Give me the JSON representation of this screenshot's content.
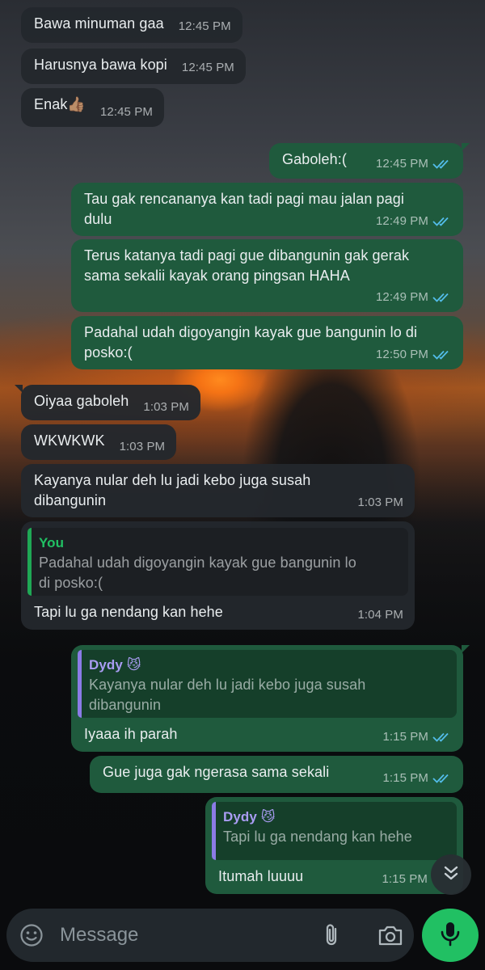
{
  "messages": [
    {
      "text": "Bawa minuman gaa",
      "time": "12:45 PM"
    },
    {
      "text": "Harusnya bawa kopi",
      "time": "12:45 PM"
    },
    {
      "text": "Enak👍🏽",
      "time": "12:45 PM"
    },
    {
      "text": "Gaboleh:(",
      "time": "12:45 PM"
    },
    {
      "text": "Tau gak rencananya kan tadi pagi mau jalan pagi dulu",
      "time": "12:49 PM"
    },
    {
      "text": "Terus katanya tadi pagi gue dibangunin gak gerak sama sekalii kayak orang pingsan HAHA",
      "time": "12:49 PM"
    },
    {
      "text": "Padahal udah digoyangin kayak gue bangunin lo di posko:(",
      "time": "12:50 PM"
    },
    {
      "text": "Oiyaa gaboleh",
      "time": "1:03 PM"
    },
    {
      "text": "WKWKWK",
      "time": "1:03 PM"
    },
    {
      "text": "Kayanya nular deh lu jadi kebo juga susah dibangunin",
      "time": "1:03 PM"
    },
    {
      "text": "Tapi lu ga nendang kan hehe",
      "time": "1:04 PM",
      "quote": {
        "name": "You",
        "text": "Padahal udah digoyangin kayak gue bangunin lo di posko:("
      }
    },
    {
      "text": "Iyaaa ih parah",
      "time": "1:15 PM",
      "quote": {
        "name": "Dydy 😼",
        "text": "Kayanya nular deh lu jadi kebo juga susah dibangunin"
      }
    },
    {
      "text": "Gue juga gak ngerasa sama sekali",
      "time": "1:15 PM"
    },
    {
      "text": "Itumah luuuu",
      "time": "1:15 PM",
      "quote": {
        "name": "Dydy 😼",
        "text": "Tapi lu ga nendang kan hehe"
      }
    }
  ],
  "composer": {
    "placeholder": "Message"
  },
  "icons": {
    "emoji": "emoji-icon",
    "attach": "paperclip-icon",
    "camera": "camera-icon",
    "mic": "microphone-icon",
    "scroll": "double-chevron-down-icon",
    "read_receipt": "double-check-icon"
  },
  "colors": {
    "outgoing_bubble": "#1f5a3d",
    "incoming_bubble": "#23282d",
    "read_tick": "#53bdeb",
    "accent": "#21c063",
    "quote_you": "#21c063",
    "quote_dydy": "#a99cf2"
  }
}
